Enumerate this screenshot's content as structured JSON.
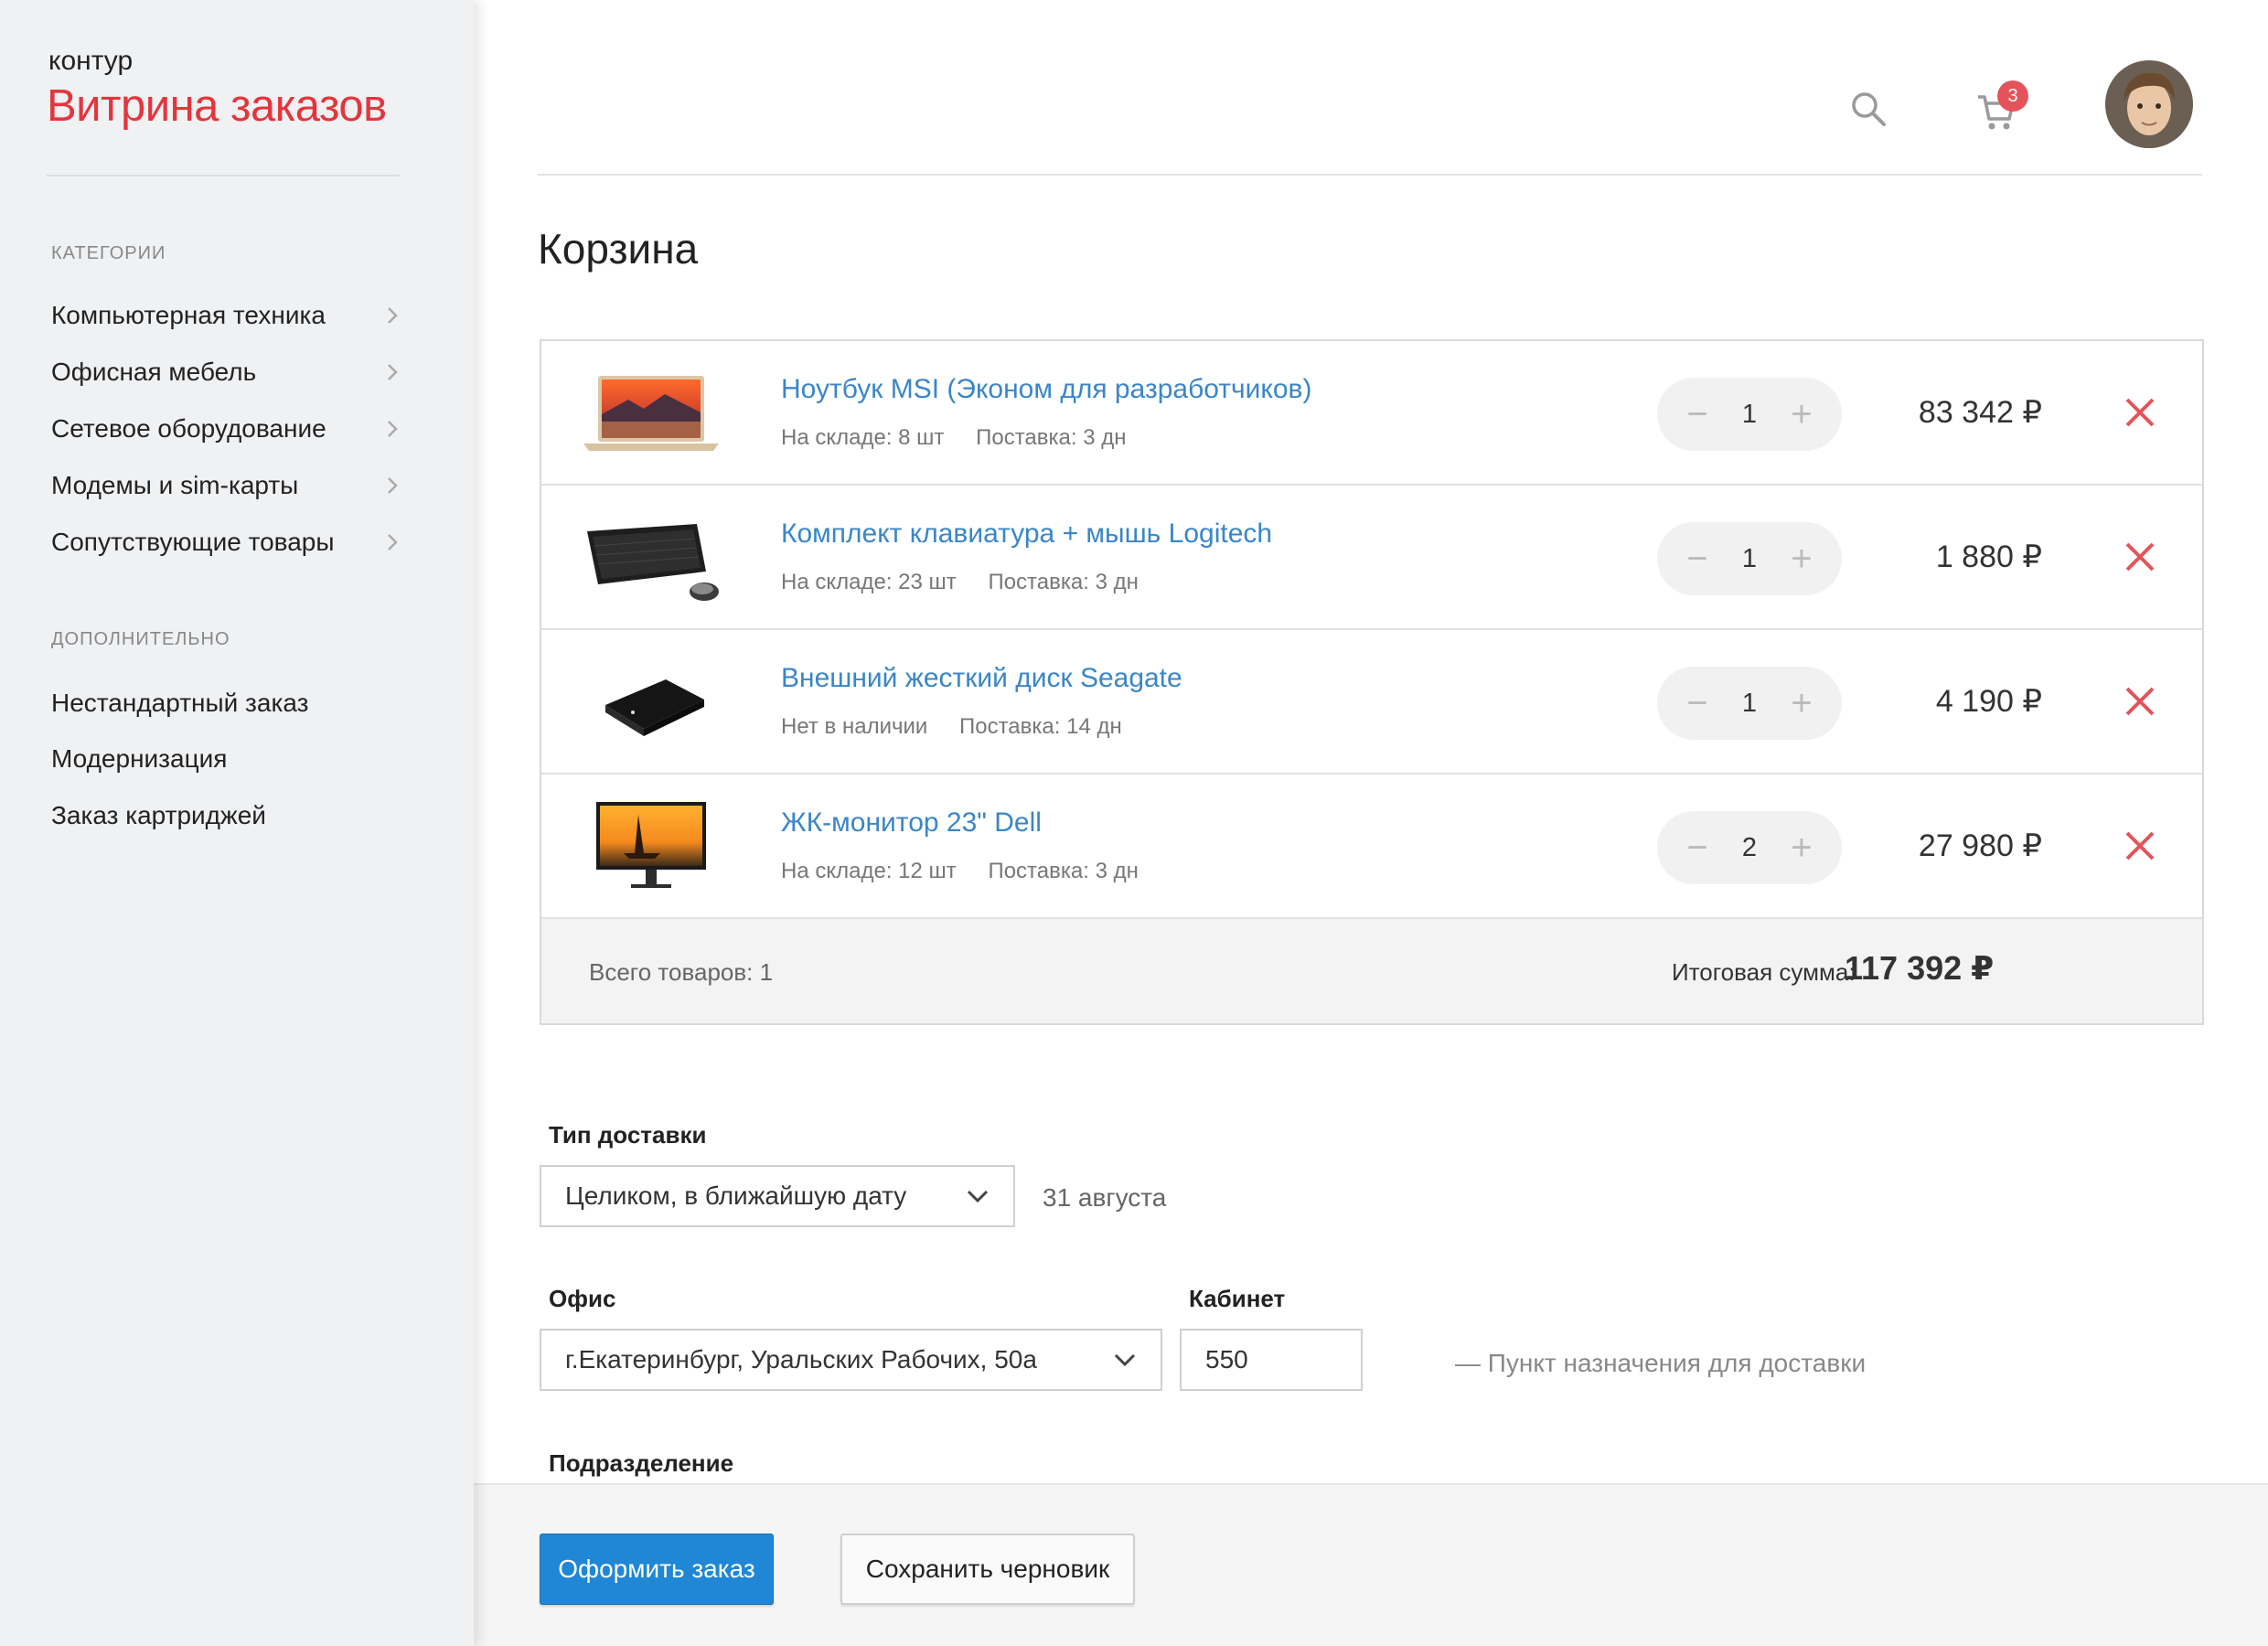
{
  "brand": {
    "small": "контур",
    "big": "Витрина заказов"
  },
  "sidebar": {
    "section1": "Категории",
    "items1": [
      {
        "label": "Компьютерная техника"
      },
      {
        "label": "Офисная мебель"
      },
      {
        "label": "Сетевое оборудование"
      },
      {
        "label": "Модемы и sim-карты"
      },
      {
        "label": "Сопутствующие товары"
      }
    ],
    "section2": "Дополнительно",
    "items2": [
      {
        "label": "Нестандартный заказ"
      },
      {
        "label": "Модернизация"
      },
      {
        "label": "Заказ картриджей"
      }
    ]
  },
  "header": {
    "cart_count": "3",
    "icons": [
      "search-icon",
      "cart-icon",
      "avatar"
    ]
  },
  "page_title": "Корзина",
  "cart": {
    "items": [
      {
        "name": "Ноутбук MSI (Эконом для разработчиков)",
        "stock": "На складе: 8 шт",
        "delivery": "Поставка: 3 дн",
        "qty": "1",
        "price": "83 342 ₽"
      },
      {
        "name": "Комплект клавиатура + мышь Logitech",
        "stock": "На складе: 23 шт",
        "delivery": "Поставка: 3 дн",
        "qty": "1",
        "price": "1 880 ₽"
      },
      {
        "name": "Внешний жесткий диск Seagate",
        "stock": "Нет в наличии",
        "delivery": "Поставка: 14 дн",
        "qty": "1",
        "price": "4 190 ₽"
      },
      {
        "name": "ЖК-монитор 23\" Dell",
        "stock": "На складе: 12 шт",
        "delivery": "Поставка: 3 дн",
        "qty": "2",
        "price": "27 980 ₽"
      }
    ],
    "minus": "−",
    "plus": "+",
    "total_count": "Всего товаров: 1",
    "total_label": "Итоговая сумма:",
    "total_value": "117 392 ₽"
  },
  "form": {
    "delivery_label": "Тип доставки",
    "delivery_value": "Целиком, в ближайшую дату",
    "delivery_date": "31 августа",
    "office_label": "Офис",
    "office_value": "г.Екатеринбург, Уральских Рабочих, 50а",
    "room_label": "Кабинет",
    "room_value": "550",
    "destination_hint": "— Пункт назначения для доставки",
    "division_label": "Подразделение"
  },
  "footer": {
    "submit": "Оформить заказ",
    "save_draft": "Сохранить черновик"
  },
  "colors": {
    "accent": "#e4353d",
    "link": "#3a86c8",
    "primary_button": "#1f87d6",
    "remove": "#e4535a"
  }
}
